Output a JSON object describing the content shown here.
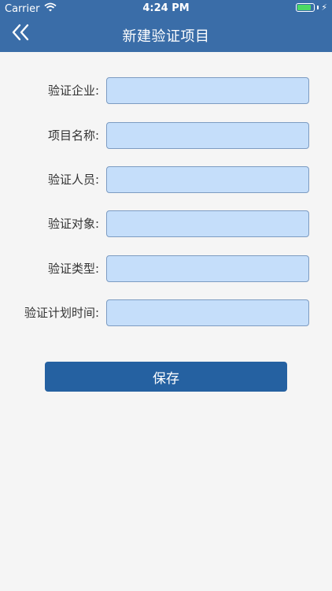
{
  "status_bar": {
    "carrier": "Carrier",
    "time": "4:24 PM"
  },
  "nav": {
    "title": "新建验证项目",
    "back_icon": "double-chevron-left-icon"
  },
  "form": {
    "fields": [
      {
        "label": "验证企业:",
        "value": ""
      },
      {
        "label": "项目名称:",
        "value": ""
      },
      {
        "label": "验证人员:",
        "value": ""
      },
      {
        "label": "验证对象:",
        "value": ""
      },
      {
        "label": "验证类型:",
        "value": ""
      },
      {
        "label": "验证计划时间:",
        "value": ""
      }
    ]
  },
  "save_label": "保存",
  "colors": {
    "header": "#3a6da8",
    "input_bg": "#c5defa",
    "button": "#2561a1",
    "background": "#f5f5f5"
  }
}
